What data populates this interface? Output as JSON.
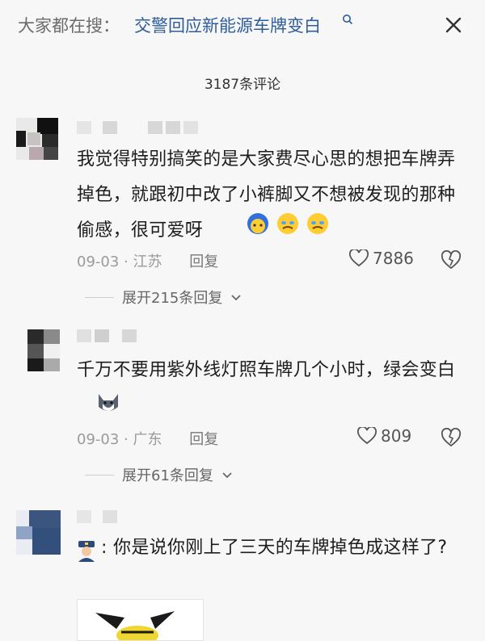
{
  "search": {
    "prefix": "大家都在搜：",
    "term": "交警回应新能源车牌变白"
  },
  "comments_count": "3187条评论",
  "comments": [
    {
      "text": "我觉得特别搞笑的是大家费尽心思的想把车牌弄掉色，就跟初中改了小裤脚又不想被发现的那种偷感，很可爱呀",
      "date": "09-03",
      "location": "江苏",
      "reply_label": "回复",
      "likes": "7886",
      "expand": "展开215条回复"
    },
    {
      "text": "千万不要用紫外线灯照车牌几个小时，绿会变白",
      "date": "09-03",
      "location": "广东",
      "reply_label": "回复",
      "likes": "809",
      "expand": "展开61条回复"
    },
    {
      "text": "你是说你刚上了三天的车牌掉色成这样了?"
    }
  ],
  "icons": [
    "search-icon",
    "close-icon",
    "heart-icon",
    "broken-heart-icon",
    "chevron-down-icon"
  ],
  "colors": {
    "link": "#2f5d9a",
    "meta": "#9a9a9a",
    "background": "#f7f7f8"
  }
}
